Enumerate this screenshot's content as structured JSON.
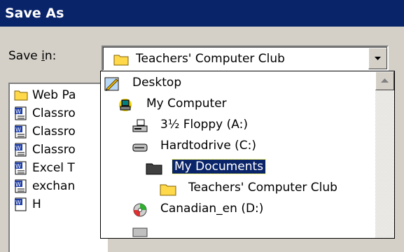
{
  "dialog": {
    "title": "Save As"
  },
  "save_in": {
    "label_prefix": "Save ",
    "label_accel": "i",
    "label_suffix": "n:",
    "current_value": "Teachers' Computer Club",
    "current_icon": "folder-icon"
  },
  "file_list": {
    "items": [
      {
        "label": "Web Pa",
        "icon": "folder-icon"
      },
      {
        "label": "Classro",
        "icon": "word-document-icon"
      },
      {
        "label": "Classro",
        "icon": "word-document-icon"
      },
      {
        "label": "Classro",
        "icon": "word-document-icon"
      },
      {
        "label": "Excel T",
        "icon": "word-document-icon"
      },
      {
        "label": "exchan",
        "icon": "word-document-icon"
      },
      {
        "label": "H",
        "icon": "word-document-icon"
      }
    ]
  },
  "dropdown": {
    "items": [
      {
        "label": "Desktop",
        "icon": "desktop-icon",
        "selected": false
      },
      {
        "label": "My Computer",
        "icon": "my-computer-icon",
        "selected": false
      },
      {
        "label": "3½ Floppy (A:)",
        "icon": "floppy-drive-icon",
        "selected": false
      },
      {
        "label": "Hardtodrive (C:)",
        "icon": "hard-drive-icon",
        "selected": false
      },
      {
        "label": "My Documents",
        "icon": "folder-icon",
        "selected": true
      },
      {
        "label": "Teachers' Computer Club",
        "icon": "folder-icon",
        "selected": false
      },
      {
        "label": "Canadian_en (D:)",
        "icon": "cd-drive-icon",
        "selected": false
      }
    ]
  },
  "colors": {
    "titlebar": "#0a246a",
    "selection": "#0a246a",
    "face": "#d4d0c8",
    "folder": "#ffd94a"
  }
}
